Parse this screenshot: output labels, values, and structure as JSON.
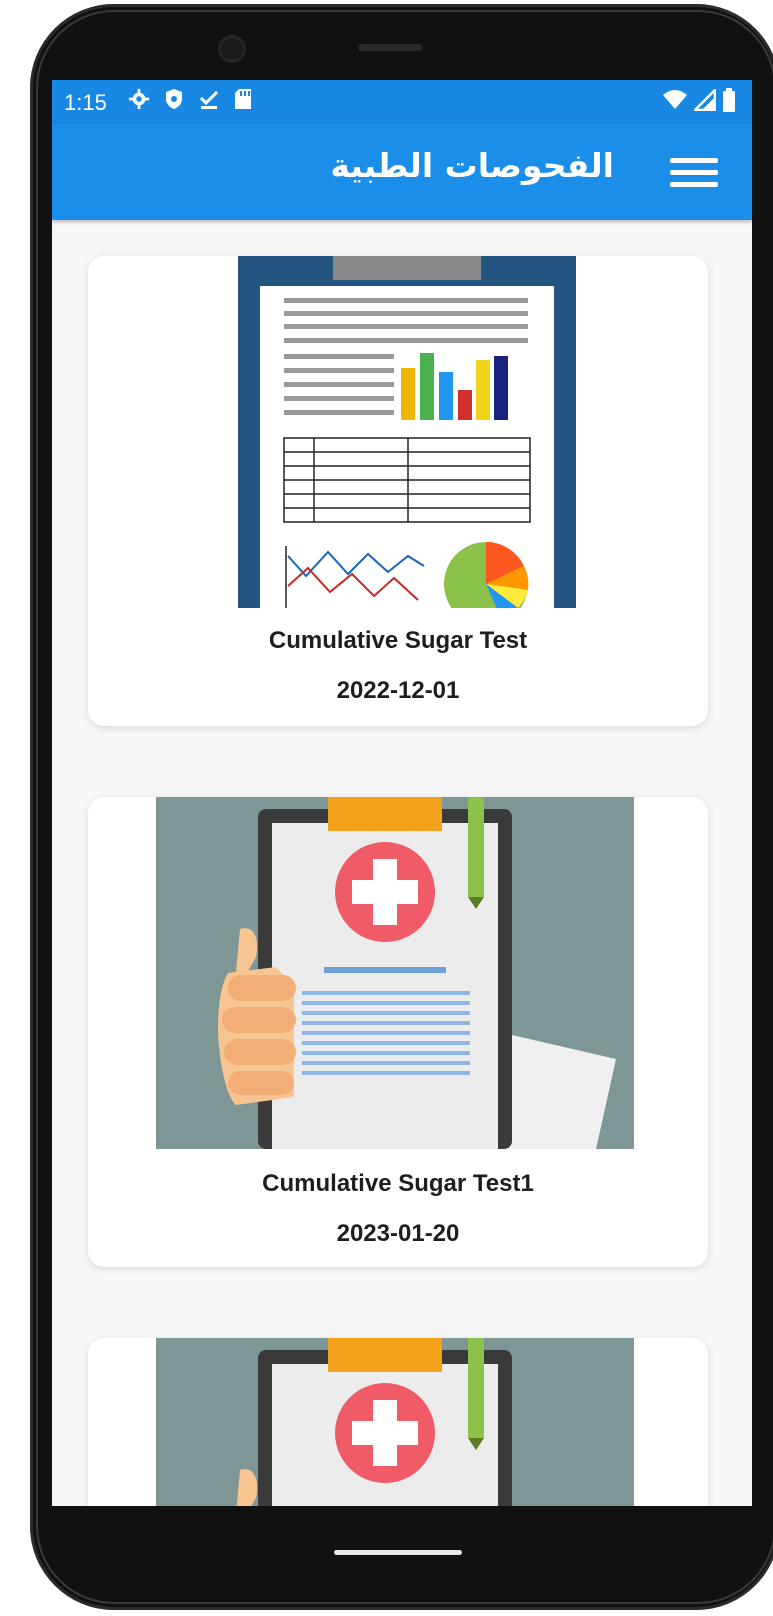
{
  "status_bar": {
    "time": "1:15"
  },
  "app_bar": {
    "title": "الفحوصات الطبية"
  },
  "cards": [
    {
      "title": "Cumulative Sugar Test",
      "date": "2022-12-01"
    },
    {
      "title": "Cumulative Sugar Test1",
      "date": "2023-01-20"
    },
    {
      "title": "",
      "date": ""
    }
  ],
  "colors": {
    "app_bar": "#1a8ee8",
    "status_bar": "#1888e4",
    "background": "#f7f7f7"
  },
  "icons": [
    "settings-icon",
    "shield-icon",
    "download-done-icon",
    "sd-card-icon",
    "wifi-icon",
    "signal-icon",
    "battery-icon",
    "menu-icon"
  ]
}
